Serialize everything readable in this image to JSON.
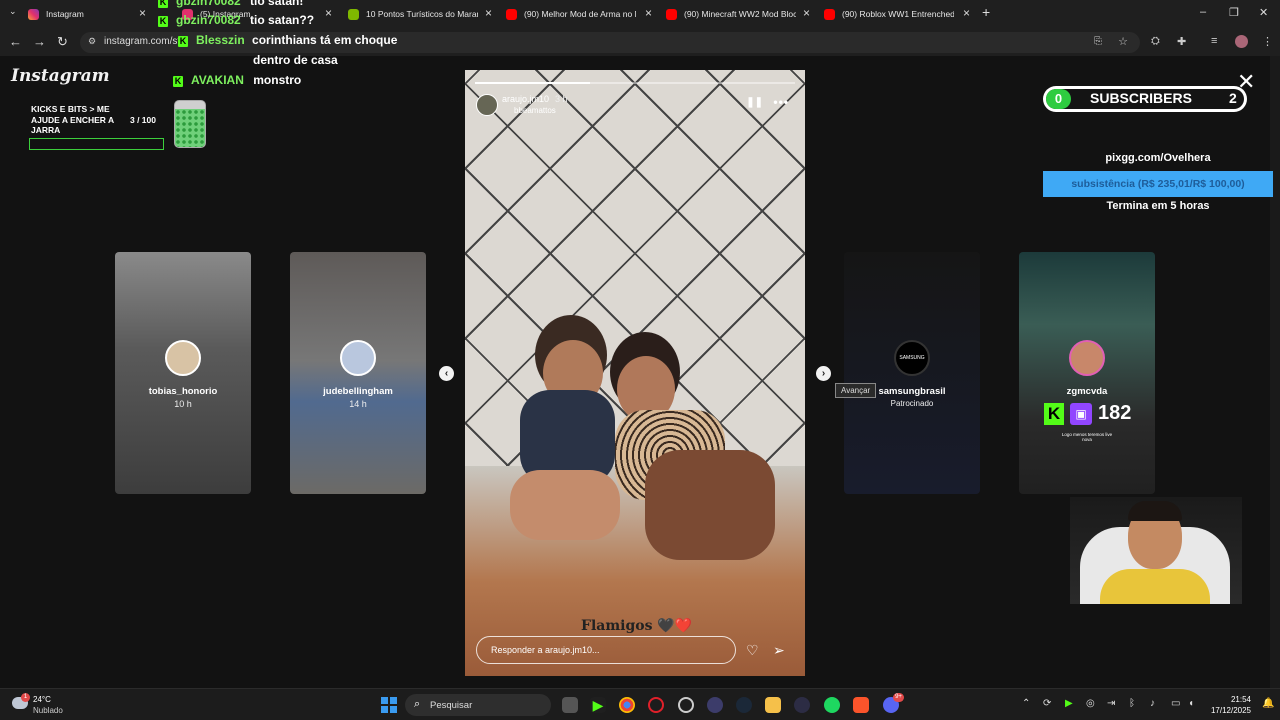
{
  "tabs": [
    {
      "label": "Instagram",
      "color": "#e1306c",
      "active": true
    },
    {
      "label": "(5) Instagram",
      "color": "#e1306c"
    },
    {
      "label": "10 Pontos Turísticos do Maranh",
      "color": "#7fb800"
    },
    {
      "label": "(90) Melhor Mod de Arma no M",
      "color": "#ff0000"
    },
    {
      "label": "(90) Minecraft WW2 Mod Block",
      "color": "#ff0000"
    },
    {
      "label": "(90) Roblox WW1 Entrenched (",
      "color": "#ff0000"
    }
  ],
  "address": {
    "url": "instagram.com/st"
  },
  "instagram_logo": "Instagram",
  "chat": [
    {
      "user": "gbzin70082",
      "msg": "tio satan!"
    },
    {
      "user": "gbzin70082",
      "msg": "tio satan??"
    },
    {
      "user": "Blesszin",
      "msg": "corinthians tá em choque"
    },
    {
      "user": "",
      "msg": "dentro de casa"
    },
    {
      "user": "AVAKIAN",
      "msg": "monstro"
    }
  ],
  "jar": {
    "title": "KICKS E BITS > ME AJUDE A ENCHER A JARRA",
    "count": "3  / 100"
  },
  "cards": [
    {
      "name": "tobias_honorio",
      "time": "10 h"
    },
    {
      "name": "judebellingham",
      "time": "14 h"
    },
    {
      "name": "samsungbrasil",
      "time": "Patrocinado",
      "avatar_text": "SAMSUNG"
    },
    {
      "name": "zgmcvda",
      "time": "",
      "badge": "182",
      "caption": "Logo menos teremos live nova"
    }
  ],
  "story": {
    "username": "araujo.jm10",
    "time": "3 h",
    "subtitle": "bbeamattos",
    "caption": "Flamigos 🖤❤️",
    "reply_placeholder": "Responder a araujo.jm10...",
    "progress": 0.36
  },
  "tooltip": "Avançar",
  "subscribers": {
    "left": "0",
    "label": "SUBSCRIBERS",
    "right": "2"
  },
  "pix": {
    "url": "pixgg.com/Ovelhera",
    "goal": "subsistência (R$ 235,01/R$ 100,00)",
    "ends": "Termina em 5 horas"
  },
  "taskbar": {
    "temp": "24°C",
    "weather": "Nublado",
    "search": "Pesquisar",
    "time": "21:54",
    "date": "17/12/2025",
    "weather_badge": "1",
    "discord_badge": "9+"
  }
}
